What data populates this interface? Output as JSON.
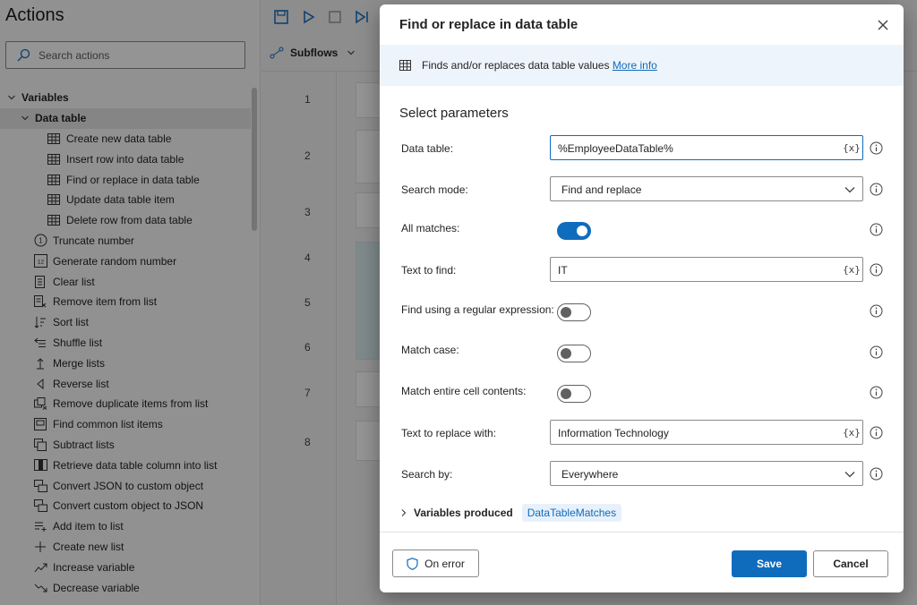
{
  "actions_panel": {
    "title": "Actions",
    "search": {
      "placeholder": "Search actions",
      "value": "",
      "icon": "search-icon"
    },
    "tree": [
      {
        "label": "Variables",
        "icon": "chevron-down-icon",
        "kind": "group"
      },
      {
        "label": "Data table",
        "icon": "chevron-down-icon",
        "kind": "subgroup"
      },
      {
        "label": "Create new data table",
        "icon": "table-icon"
      },
      {
        "label": "Insert row into data table",
        "icon": "table-icon"
      },
      {
        "label": "Find or replace in data table",
        "icon": "table-icon"
      },
      {
        "label": "Update data table item",
        "icon": "table-icon"
      },
      {
        "label": "Delete row from data table",
        "icon": "table-icon"
      },
      {
        "label": "Truncate number",
        "icon": "number-circle-icon"
      },
      {
        "label": "Generate random number",
        "icon": "random-number-icon"
      },
      {
        "label": "Clear list",
        "icon": "list-clear-icon"
      },
      {
        "label": "Remove item from list",
        "icon": "list-remove-icon"
      },
      {
        "label": "Sort list",
        "icon": "sort-icon"
      },
      {
        "label": "Shuffle list",
        "icon": "shuffle-icon"
      },
      {
        "label": "Merge lists",
        "icon": "merge-icon"
      },
      {
        "label": "Reverse list",
        "icon": "reverse-icon"
      },
      {
        "label": "Remove duplicate items from list",
        "icon": "duplicate-remove-icon"
      },
      {
        "label": "Find common list items",
        "icon": "common-items-icon"
      },
      {
        "label": "Subtract lists",
        "icon": "subtract-icon"
      },
      {
        "label": "Retrieve data table column into list",
        "icon": "column-icon"
      },
      {
        "label": "Convert JSON to custom object",
        "icon": "json-icon"
      },
      {
        "label": "Convert custom object to JSON",
        "icon": "json-icon"
      },
      {
        "label": "Add item to list",
        "icon": "list-add-icon"
      },
      {
        "label": "Create new list",
        "icon": "plus-icon"
      },
      {
        "label": "Increase variable",
        "icon": "trend-up-icon"
      },
      {
        "label": "Decrease variable",
        "icon": "trend-down-icon"
      }
    ]
  },
  "workspace": {
    "subflows_label": "Subflows",
    "line_numbers": [
      "1",
      "2",
      "3",
      "4",
      "5",
      "6",
      "7",
      "8"
    ]
  },
  "dialog": {
    "title": "Find or replace in data table",
    "info_text": "Finds and/or replaces data table values",
    "more_info_label": "More info",
    "section_title": "Select parameters",
    "params": {
      "data_table": {
        "label": "Data table:",
        "value": "%EmployeeDataTable%",
        "var_btn": "{x}"
      },
      "search_mode": {
        "label": "Search mode:",
        "value": "Find and replace"
      },
      "all_matches": {
        "label": "All matches:",
        "on": true
      },
      "text_to_find": {
        "label": "Text to find:",
        "value": "IT",
        "var_btn": "{x}"
      },
      "regex": {
        "label": "Find using a regular expression:",
        "on": false
      },
      "match_case": {
        "label": "Match case:",
        "on": false
      },
      "match_entire": {
        "label": "Match entire cell contents:",
        "on": false
      },
      "replace_with": {
        "label": "Text to replace with:",
        "value": "Information Technology",
        "var_btn": "{x}"
      },
      "search_by": {
        "label": "Search by:",
        "value": "Everywhere"
      }
    },
    "variables_produced_label": "Variables produced",
    "variable_chip": "DataTableMatches",
    "on_error_label": "On error",
    "save_label": "Save",
    "cancel_label": "Cancel",
    "accent_color": "#0f6cbd"
  }
}
